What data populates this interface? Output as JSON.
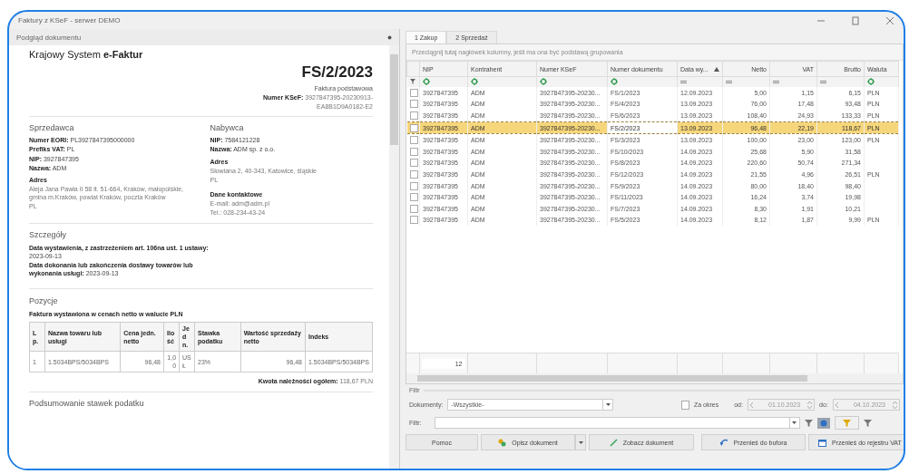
{
  "window": {
    "title": "Faktury z KSeF - serwer DEMO"
  },
  "preview_panel": {
    "title": "Podgląd dokumentu",
    "document": {
      "system_title": "Krajowy System **e-Faktur**",
      "number": "FS/2/2023",
      "type": "Faktura podstawowa",
      "ksef": "**Numer KSeF:** 3927847395-20230913-EA8B1D9A0182-E2",
      "seller": {
        "heading": "Sprzedawca",
        "lines": [
          "**Numer EORI:** PL3927847395000000",
          "**Prefiks VAT:** PL",
          "**NIP:** 3927847395",
          "**Nazwa:** ADM"
        ],
        "address_label": "Adres",
        "address": "Aleja Jana Pawła II 58 lt. 51-664, Kraków, małopolskie, gmina m.Kraków, powiat Kraków, poczta Kraków",
        "country": "PL"
      },
      "buyer": {
        "heading": "Nabywca",
        "lines": [
          "**NIP:** 7584121228",
          "**Nazwa:** ADM sp. z o.o."
        ],
        "address_label": "Adres",
        "address": "Słowiana 2, 40-343, Katowice, śląskie",
        "country": "PL",
        "contact_label": "Dane kontaktowe",
        "contact_lines": [
          "E-mail: adm@adm.pl",
          "Tel.: 028-234-43-24"
        ]
      },
      "details": {
        "heading": "Szczegóły",
        "lines": [
          "**Data wystawienia, z zastrzeżeniem art. 106na ust. 1 ustawy:** 2023-09-13",
          "**Data dokonania lub zakończenia dostawy towarów lub wykonania usługi:** 2023-09-13"
        ]
      },
      "items": {
        "heading": "Pozycje",
        "note": "Faktura wystawiona w cenach netto w walucie PLN",
        "columns": [
          "Lp.",
          "Nazwa towaru lub usługi",
          "Cena jedn. netto",
          "Ilość",
          "Jedn.",
          "Stawka podatku",
          "Wartość sprzedaży netto",
          "Indeks"
        ],
        "rows": [
          [
            "1",
            "1.5034BPS/5034BPS",
            "96,48",
            "1,00",
            "USŁ",
            "23%",
            "96,48",
            "1.5034BPS/5034BPS"
          ]
        ],
        "total": "**Kwota należności ogółem:** 118,67 PLN"
      },
      "summary_heading": "Podsumowanie stawek podatku"
    }
  },
  "tabs": [
    {
      "label": "1 Zakup",
      "selected": true
    },
    {
      "label": "2 Sprzedaż",
      "selected": false
    }
  ],
  "grid": {
    "group_hint": "Przeciągnij tutaj nagłówek kolumny, jeśli ma ona być podstawą grupowania",
    "columns": [
      {
        "label": "NIP",
        "kind": "text",
        "sorted": false
      },
      {
        "label": "Kontrahent",
        "kind": "text",
        "sorted": false
      },
      {
        "label": "Numer KSeF",
        "kind": "text",
        "sorted": false
      },
      {
        "label": "Numer dokumentu",
        "kind": "text",
        "sorted": false
      },
      {
        "label": "Data wy...",
        "kind": "date",
        "sorted": true
      },
      {
        "label": "Netto",
        "kind": "number",
        "sorted": false
      },
      {
        "label": "VAT",
        "kind": "number",
        "sorted": false
      },
      {
        "label": "Brutto",
        "kind": "number",
        "sorted": false
      },
      {
        "label": "Waluta",
        "kind": "text",
        "sorted": false
      }
    ],
    "rows": [
      {
        "checked": false,
        "selected": false,
        "cells": [
          "3927847395",
          "ADM",
          "3927847395-20230...",
          "FS/1/2023",
          "12.09.2023",
          "5,00",
          "1,15",
          "6,15",
          "PLN"
        ]
      },
      {
        "checked": false,
        "selected": false,
        "cells": [
          "3927847395",
          "ADM",
          "3927847395-20230...",
          "FS/4/2023",
          "13.09.2023",
          "76,00",
          "17,48",
          "93,48",
          "PLN"
        ]
      },
      {
        "checked": false,
        "selected": false,
        "cells": [
          "3927847395",
          "ADM",
          "3927847395-20230...",
          "FS/6/2023",
          "13.09.2023",
          "108,40",
          "24,93",
          "133,33",
          "PLN"
        ]
      },
      {
        "checked": false,
        "selected": true,
        "cells": [
          "3927847395",
          "ADM",
          "3927847395-20230...",
          "FS/2/2023",
          "13.09.2023",
          "96,48",
          "22,19",
          "118,67",
          "PLN"
        ]
      },
      {
        "checked": false,
        "selected": false,
        "cells": [
          "3927847395",
          "ADM",
          "3927847395-20230...",
          "FS/3/2023",
          "13.09.2023",
          "100,00",
          "23,00",
          "123,00",
          "PLN"
        ]
      },
      {
        "checked": false,
        "selected": false,
        "cells": [
          "3927847395",
          "ADM",
          "3927847395-20230...",
          "FS/10/2023",
          "14.09.2023",
          "25,68",
          "5,90",
          "31,58",
          ""
        ]
      },
      {
        "checked": false,
        "selected": false,
        "cells": [
          "3927847395",
          "ADM",
          "3927847395-20230...",
          "FS/8/2023",
          "14.09.2023",
          "220,60",
          "50,74",
          "271,34",
          ""
        ]
      },
      {
        "checked": false,
        "selected": false,
        "cells": [
          "3927847395",
          "ADM",
          "3927847395-20230...",
          "FS/12/2023",
          "14.09.2023",
          "21,55",
          "4,96",
          "26,51",
          "PLN"
        ]
      },
      {
        "checked": false,
        "selected": false,
        "cells": [
          "3927847395",
          "ADM",
          "3927847395-20230...",
          "FS/9/2023",
          "14.09.2023",
          "80,00",
          "18,40",
          "98,40",
          ""
        ]
      },
      {
        "checked": false,
        "selected": false,
        "cells": [
          "3927847395",
          "ADM",
          "3927847395-20230...",
          "FS/11/2023",
          "14.09.2023",
          "16,24",
          "3,74",
          "19,98",
          ""
        ]
      },
      {
        "checked": false,
        "selected": false,
        "cells": [
          "3927847395",
          "ADM",
          "3927847395-20230...",
          "FS/7/2023",
          "14.09.2023",
          "8,30",
          "1,91",
          "10,21",
          ""
        ]
      },
      {
        "checked": false,
        "selected": false,
        "cells": [
          "3927847395",
          "ADM",
          "3927847395-20230...",
          "FS/5/2023",
          "14.09.2023",
          "8,12",
          "1,87",
          "9,99",
          "PLN"
        ]
      }
    ],
    "footer_count": "12"
  },
  "filter": {
    "title": "Filtr",
    "documents_label": "Dokumenty:",
    "documents_value": "-Wszystkie-",
    "period_label": "Za okres",
    "period_checked": false,
    "from_label": "od:",
    "from_value": "01.10.2023",
    "to_label": "do:",
    "to_value": "04.10.2023",
    "filter_label": "Filtr:"
  },
  "buttons": [
    {
      "label": "Pomoc",
      "split": false
    },
    {
      "label": "Opisz dokument",
      "split": true
    },
    {
      "label": "Zobacz dokument",
      "split": false
    },
    {
      "label": "Przenieś do bufora",
      "split": false
    },
    {
      "label": "Przenieś do rejestru VAT",
      "split": false
    }
  ]
}
